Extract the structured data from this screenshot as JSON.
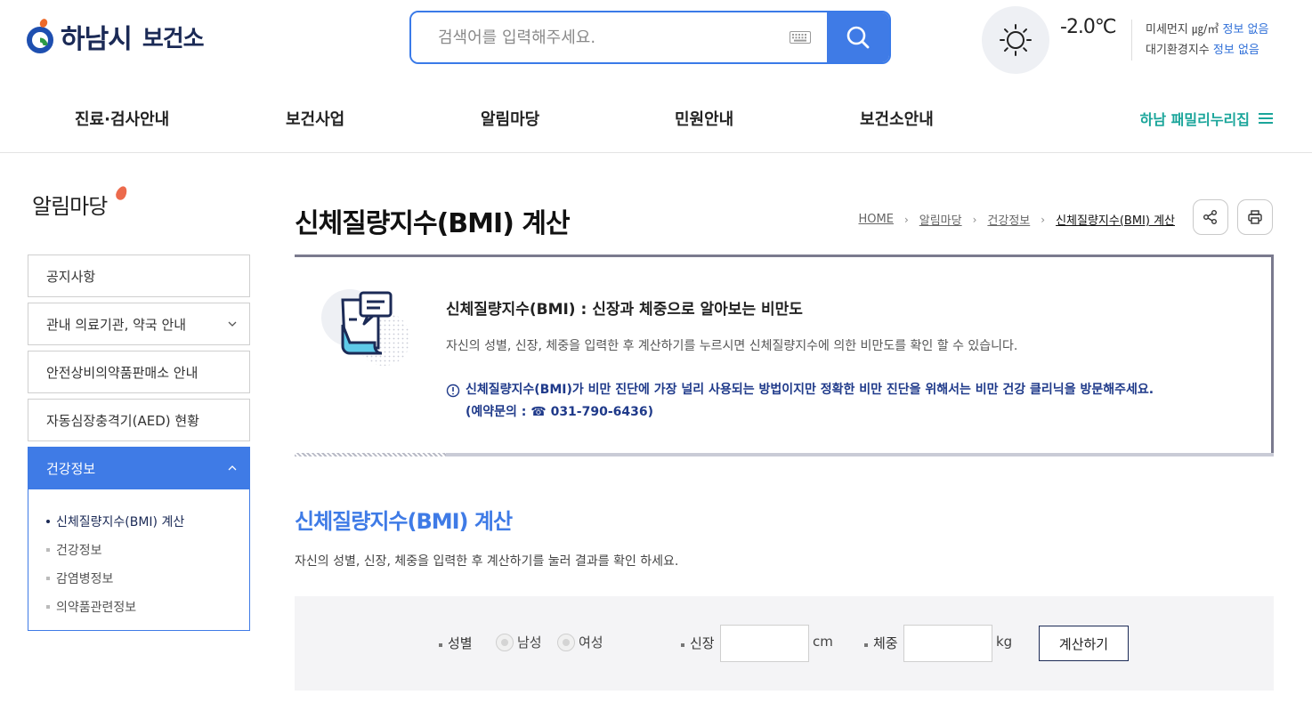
{
  "header": {
    "logo_text": "하남시",
    "logo_sub": "보건소",
    "search_placeholder": "검색어를 입력해주세요.",
    "temperature": "-2.0℃",
    "fine_dust_label": "미세먼지 ㎍/㎥",
    "fine_dust_value": "정보 없음",
    "air_index_label": "대기환경지수",
    "air_index_value": "정보 없음"
  },
  "gnb": {
    "items": [
      "진료·검사안내",
      "보건사업",
      "알림마당",
      "민원안내",
      "보건소안내"
    ],
    "family_link": "하남 패밀리누리집"
  },
  "sidebar": {
    "title": "알림마당",
    "items": [
      {
        "label": "공지사항"
      },
      {
        "label": "관내 의료기관, 약국 안내"
      },
      {
        "label": "안전상비의약품판매소 안내"
      },
      {
        "label": "자동심장충격기(AED) 현황"
      },
      {
        "label": "건강정보"
      }
    ],
    "sub_items": [
      {
        "label": "신체질량지수(BMI) 계산"
      },
      {
        "label": "건강정보"
      },
      {
        "label": "감염병정보"
      },
      {
        "label": "의약품관련정보"
      }
    ]
  },
  "main": {
    "page_title": "신체질량지수(BMI) 계산",
    "breadcrumb": [
      "HOME",
      "알림마당",
      "건강정보",
      "신체질량지수(BMI) 계산"
    ],
    "intro": {
      "heading": "신체질량지수(BMI) : 신장과 체중으로 알아보는 비만도",
      "description": "자신의 성별, 신장, 체중을 입력한 후 계산하기를 누르시면 신체질량지수에 의한 비만도를 확인 할 수 있습니다.",
      "warning_line1": "신체질량지수(BMI)가 비만 진단에 가장 널리 사용되는 방법이지만 정확한 비만 진단을 위해서는 비만 건강 클리닉을 방문해주세요.",
      "warning_line2": "(예약문의 : ☎ 031-790-6436)"
    },
    "section_title": "신체질량지수(BMI) 계산",
    "section_desc": "자신의 성별, 신장, 체중을 입력한 후 계산하기를 눌러 결과를 확인 하세요.",
    "form": {
      "gender_label": "성별",
      "male": "남성",
      "female": "여성",
      "height_label": "신장",
      "height_unit": "cm",
      "height_value": "",
      "weight_label": "체중",
      "weight_unit": "kg",
      "weight_value": "",
      "submit": "계산하기"
    }
  }
}
